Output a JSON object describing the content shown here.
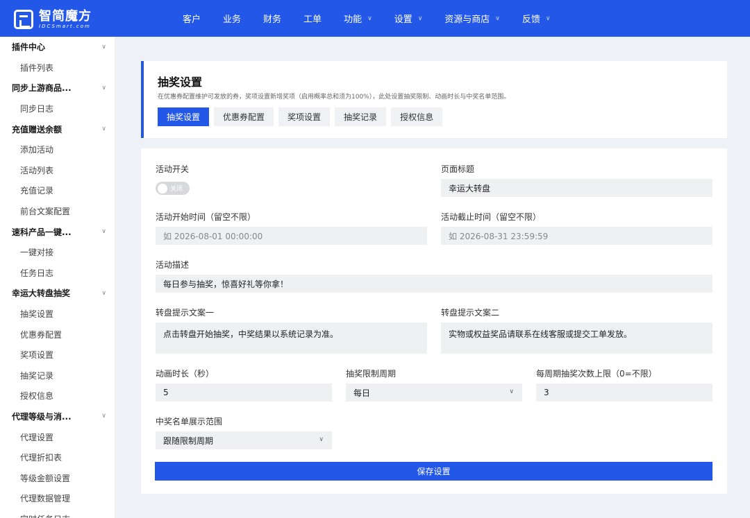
{
  "brand": {
    "name_cn": "智简魔方",
    "name_en": "IDCSmart.com"
  },
  "topnav": [
    {
      "label": "客户",
      "has_dropdown": false
    },
    {
      "label": "业务",
      "has_dropdown": false
    },
    {
      "label": "财务",
      "has_dropdown": false
    },
    {
      "label": "工单",
      "has_dropdown": false
    },
    {
      "label": "功能",
      "has_dropdown": true
    },
    {
      "label": "设置",
      "has_dropdown": true
    },
    {
      "label": "资源与商店",
      "has_dropdown": true
    },
    {
      "label": "反馈",
      "has_dropdown": true
    }
  ],
  "sidebar": {
    "g1": {
      "label": "插件中心",
      "items": [
        "插件列表"
      ]
    },
    "g2": {
      "label": "同步上游商品...",
      "items": [
        "同步日志"
      ]
    },
    "g3": {
      "label": "充值赠送余额",
      "items": [
        "添加活动",
        "活动列表",
        "充值记录",
        "前台文案配置"
      ]
    },
    "g4": {
      "label": "速科产品一键...",
      "items": [
        "一键对接",
        "任务日志"
      ]
    },
    "g5": {
      "label": "幸运大转盘抽奖",
      "items": [
        "抽奖设置",
        "优惠券配置",
        "奖项设置",
        "抽奖记录",
        "授权信息"
      ]
    },
    "g6": {
      "label": "代理等级与消...",
      "items": [
        "代理设置",
        "代理折扣表",
        "等级金额设置",
        "代理数据管理",
        "定时任务日志"
      ]
    }
  },
  "header": {
    "title": "抽奖设置",
    "description": "在优惠券配置维护可发放的券，奖项设置新增奖项（启用概率总和须为100%），此处设置抽奖限制、动画时长与中奖名单范围。",
    "tabs": [
      "抽奖设置",
      "优惠券配置",
      "奖项设置",
      "抽奖记录",
      "授权信息"
    ],
    "active_tab": "抽奖设置"
  },
  "form": {
    "activity_switch": {
      "label": "活动开关",
      "state": "关闭"
    },
    "page_title": {
      "label": "页面标题",
      "value": "幸运大转盘"
    },
    "start_time": {
      "label": "活动开始时间（留空不限）",
      "placeholder": "如 2026-08-01 00:00:00"
    },
    "end_time": {
      "label": "活动截止时间（留空不限）",
      "placeholder": "如 2026-08-31 23:59:59"
    },
    "description": {
      "label": "活动描述",
      "value": "每日参与抽奖，惊喜好礼等你拿！"
    },
    "tip1": {
      "label": "转盘提示文案一",
      "value": "点击转盘开始抽奖，中奖结果以系统记录为准。"
    },
    "tip2": {
      "label": "转盘提示文案二",
      "value": "实物或权益奖品请联系在线客服或提交工单发放。"
    },
    "duration": {
      "label": "动画时长（秒）",
      "value": "5"
    },
    "limit_period": {
      "label": "抽奖限制周期",
      "value": "每日"
    },
    "limit_count": {
      "label": "每周期抽奖次数上限（0=不限）",
      "value": "3"
    },
    "winner_scope": {
      "label": "中奖名单展示范围",
      "value": "跟随限制周期"
    },
    "save_label": "保存设置"
  },
  "colors": {
    "accent": "#2357e8",
    "field_bg": "#eff0f2",
    "page_bg": "#eef1f6"
  }
}
